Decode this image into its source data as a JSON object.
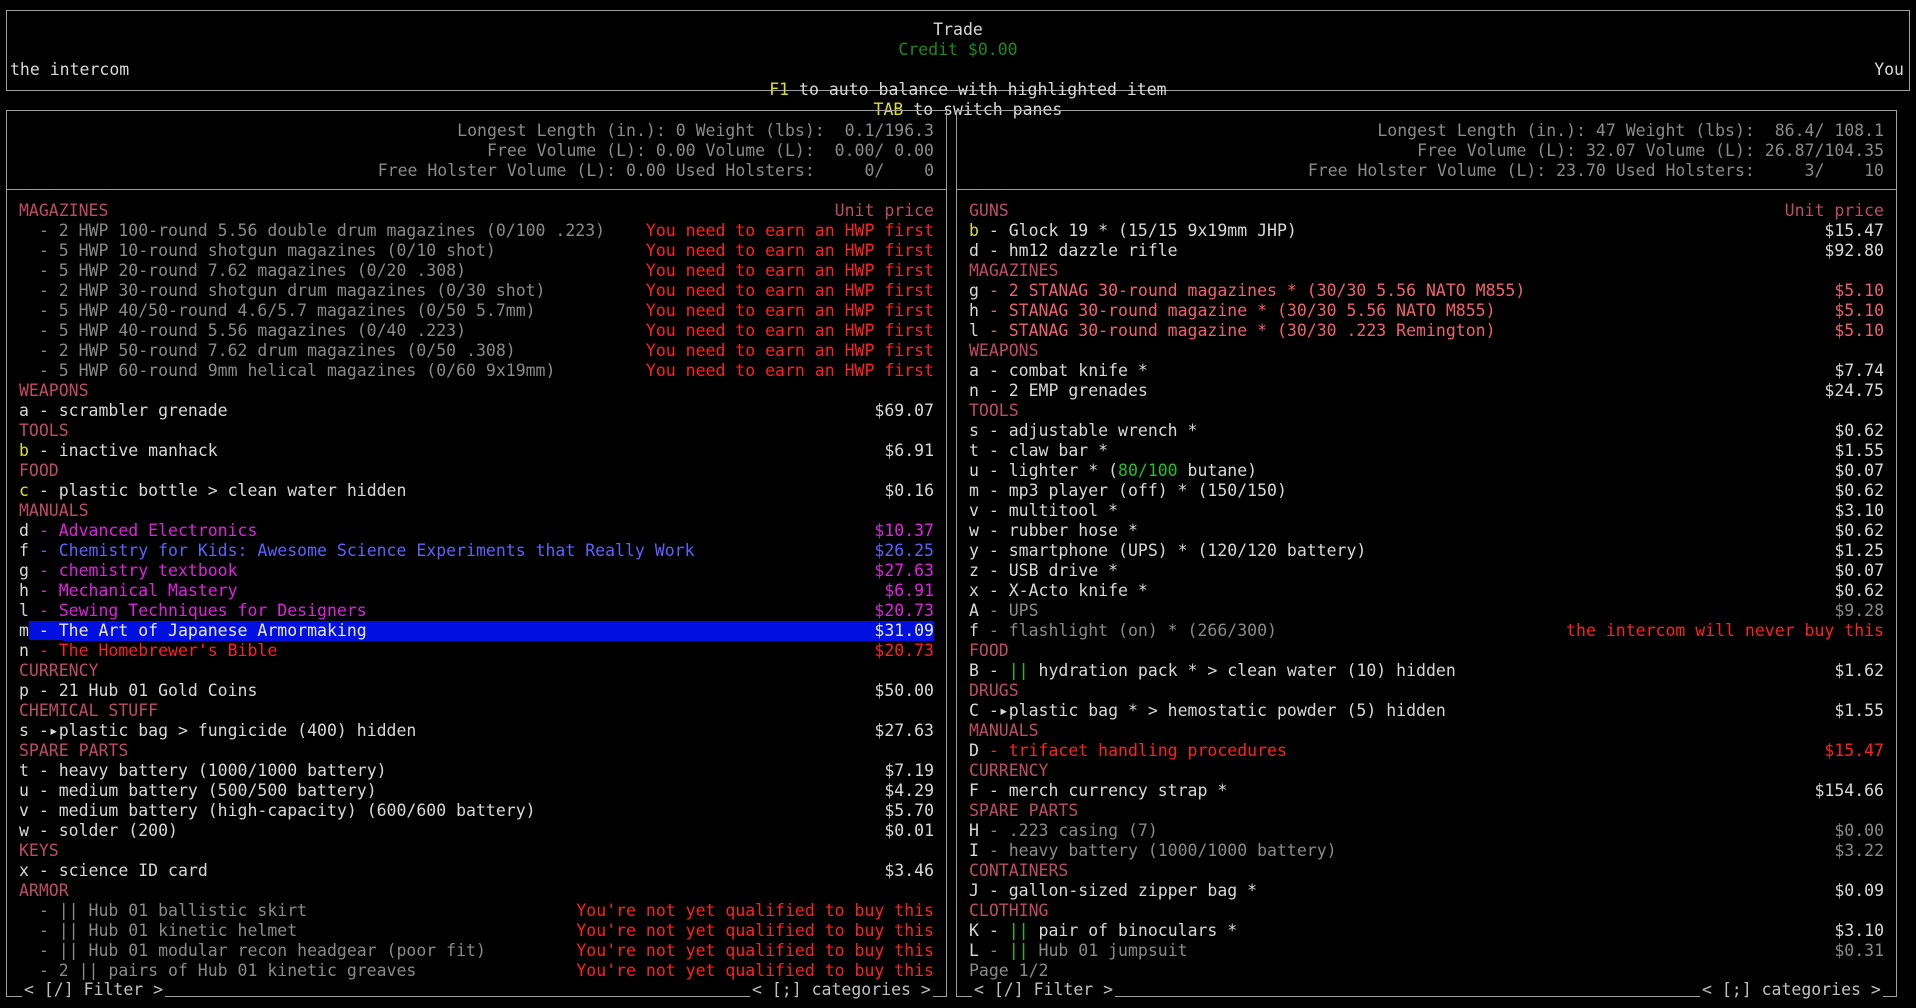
{
  "header": {
    "title": "Trade",
    "credit": "Credit $0.00",
    "npc_name": "the intercom",
    "player_name": "You",
    "f1_key": "F1",
    "f1_text": " to auto balance with highlighted item",
    "tab_key": "TAB",
    "tab_text": " to switch panes"
  },
  "left": {
    "stats": [
      "Longest Length (in.): 0 Weight (lbs):  0.1/196.3",
      "Free Volume (L): 0.00 Volume (L):  0.00/ 0.00",
      "Free Holster Volume (L): 0.00 Used Holsters:     0/    0"
    ],
    "unit_price_label": "Unit price",
    "filter_label": "< [/] Filter >",
    "categories_label": "< [;] categories >",
    "rows": [
      {
        "t": "MAGAZINES",
        "c": "hdr",
        "p": "",
        "pc": ""
      },
      {
        "t": "  - 2 HWP 100-round 5.56 double drum magazines (0/100 .223)",
        "c": "gray",
        "p": "You need to earn an HWP first",
        "pc": "red"
      },
      {
        "t": "  - 5 HWP 10-round shotgun magazines (0/10 shot)",
        "c": "gray",
        "p": "You need to earn an HWP first",
        "pc": "red"
      },
      {
        "t": "  - 5 HWP 20-round 7.62 magazines (0/20 .308)",
        "c": "gray",
        "p": "You need to earn an HWP first",
        "pc": "red"
      },
      {
        "t": "  - 2 HWP 30-round shotgun drum magazines (0/30 shot)",
        "c": "gray",
        "p": "You need to earn an HWP first",
        "pc": "red"
      },
      {
        "t": "  - 5 HWP 40/50-round 4.6/5.7 magazines (0/50 5.7mm)",
        "c": "gray",
        "p": "You need to earn an HWP first",
        "pc": "red"
      },
      {
        "t": "  - 5 HWP 40-round 5.56 magazines (0/40 .223)",
        "c": "gray",
        "p": "You need to earn an HWP first",
        "pc": "red"
      },
      {
        "t": "  - 2 HWP 50-round 7.62 drum magazines (0/50 .308)",
        "c": "gray",
        "p": "You need to earn an HWP first",
        "pc": "red"
      },
      {
        "t": "  - 5 HWP 60-round 9mm helical magazines (0/60 9x19mm)",
        "c": "gray",
        "p": "You need to earn an HWP first",
        "pc": "red"
      },
      {
        "t": "WEAPONS",
        "c": "hdr",
        "p": "",
        "pc": ""
      },
      {
        "k": "a",
        "t": " - scrambler grenade",
        "c": "white",
        "p": "$69.07",
        "pc": "white"
      },
      {
        "t": "TOOLS",
        "c": "hdr",
        "p": "",
        "pc": ""
      },
      {
        "k": "b",
        "kc": "yellow",
        "t": " - inactive manhack",
        "c": "white",
        "p": "$6.91",
        "pc": "white"
      },
      {
        "t": "FOOD",
        "c": "hdr",
        "p": "",
        "pc": ""
      },
      {
        "k": "c",
        "kc": "yellow",
        "t": " - plastic bottle > clean water hidden",
        "c": "white",
        "p": "$0.16",
        "pc": "white"
      },
      {
        "t": "MANUALS",
        "c": "hdr",
        "p": "",
        "pc": ""
      },
      {
        "k": "d",
        "t": " - Advanced Electronics",
        "c": "magenta",
        "p": "$10.37",
        "pc": "magenta"
      },
      {
        "k": "f",
        "t": " - Chemistry for Kids: Awesome Science Experiments that Really Work",
        "c": "blue",
        "p": "$26.25",
        "pc": "blue"
      },
      {
        "k": "g",
        "t": " - chemistry textbook",
        "c": "magenta",
        "p": "$27.63",
        "pc": "magenta"
      },
      {
        "k": "h",
        "t": " - Mechanical Mastery",
        "c": "magenta",
        "p": "$6.91",
        "pc": "magenta"
      },
      {
        "k": "l",
        "t": " - Sewing Techniques for Designers",
        "c": "magenta",
        "p": "$20.73",
        "pc": "magenta"
      },
      {
        "k": "m",
        "t": " - The Art of Japanese Armormaking",
        "c": "sel",
        "p": "$31.09",
        "pc": "sel",
        "selected": true
      },
      {
        "k": "n",
        "t": " - The Homebrewer's Bible",
        "c": "red",
        "p": "$20.73",
        "pc": "red"
      },
      {
        "t": "CURRENCY",
        "c": "hdr",
        "p": "",
        "pc": ""
      },
      {
        "k": "p",
        "t": " - 21 Hub 01 Gold Coins",
        "c": "white",
        "p": "$50.00",
        "pc": "white"
      },
      {
        "t": "CHEMICAL STUFF",
        "c": "hdr",
        "p": "",
        "pc": ""
      },
      {
        "k": "s",
        "t": " -▸plastic bag > fungicide (400) hidden",
        "c": "white",
        "p": "$27.63",
        "pc": "white"
      },
      {
        "t": "SPARE PARTS",
        "c": "hdr",
        "p": "",
        "pc": ""
      },
      {
        "k": "t",
        "t": " - heavy battery (1000/1000 battery)",
        "c": "white",
        "p": "$7.19",
        "pc": "white"
      },
      {
        "k": "u",
        "t": " - medium battery (500/500 battery)",
        "c": "white",
        "p": "$4.29",
        "pc": "white"
      },
      {
        "k": "v",
        "t": " - medium battery (high-capacity) (600/600 battery)",
        "c": "white",
        "p": "$5.70",
        "pc": "white"
      },
      {
        "k": "w",
        "t": " - solder (200)",
        "c": "white",
        "p": "$0.01",
        "pc": "white"
      },
      {
        "t": "KEYS",
        "c": "hdr",
        "p": "",
        "pc": ""
      },
      {
        "k": "x",
        "t": " - science ID card",
        "c": "white",
        "p": "$3.46",
        "pc": "white"
      },
      {
        "t": "ARMOR",
        "c": "hdr",
        "p": "",
        "pc": ""
      },
      {
        "t": "  - || Hub 01 ballistic skirt",
        "c": "gray",
        "p": "You're not yet qualified to buy this",
        "pc": "red"
      },
      {
        "t": "  - || Hub 01 kinetic helmet",
        "c": "gray",
        "p": "You're not yet qualified to buy this",
        "pc": "red"
      },
      {
        "t": "  - || Hub 01 modular recon headgear (poor fit)",
        "c": "gray",
        "p": "You're not yet qualified to buy this",
        "pc": "red"
      },
      {
        "t": "  - 2 || pairs of Hub 01 kinetic greaves",
        "c": "gray",
        "p": "You're not yet qualified to buy this",
        "pc": "red"
      }
    ]
  },
  "right": {
    "stats": [
      "Longest Length (in.): 47 Weight (lbs):  86.4/ 108.1",
      "Free Volume (L): 32.07 Volume (L): 26.87/104.35",
      "Free Holster Volume (L): 23.70 Used Holsters:     3/    10"
    ],
    "unit_price_label": "Unit price",
    "page_label": "Page 1/2",
    "filter_label": "< [/] Filter >",
    "categories_label": "< [;] categories >",
    "rows": [
      {
        "t": "GUNS",
        "c": "hdr",
        "p": "",
        "pc": ""
      },
      {
        "k": "b",
        "kc": "yellow",
        "t": " - Glock 19 * (15/15 9x19mm JHP)",
        "c": "white",
        "p": "$15.47",
        "pc": "white"
      },
      {
        "k": "d",
        "t": " - hm12 dazzle rifle",
        "c": "white",
        "p": "$92.80",
        "pc": "white"
      },
      {
        "t": "MAGAZINES",
        "c": "hdr",
        "p": "",
        "pc": ""
      },
      {
        "k": "g",
        "t": " - 2 STANAG 30-round magazines * (30/30 5.56 NATO M855)",
        "c": "salmon",
        "p": "$5.10",
        "pc": "salmon"
      },
      {
        "k": "h",
        "t": " - STANAG 30-round magazine * (30/30 5.56 NATO M855)",
        "c": "salmon",
        "p": "$5.10",
        "pc": "salmon"
      },
      {
        "k": "l",
        "t": " - STANAG 30-round magazine * (30/30 .223 Remington)",
        "c": "salmon",
        "p": "$5.10",
        "pc": "salmon"
      },
      {
        "t": "WEAPONS",
        "c": "hdr",
        "p": "",
        "pc": ""
      },
      {
        "k": "a",
        "t": " - combat knife *",
        "c": "white",
        "p": "$7.74",
        "pc": "white"
      },
      {
        "k": "n",
        "t": " - 2 EMP grenades",
        "c": "white",
        "p": "$24.75",
        "pc": "white"
      },
      {
        "t": "TOOLS",
        "c": "hdr",
        "p": "",
        "pc": ""
      },
      {
        "k": "s",
        "t": " - adjustable wrench *",
        "c": "white",
        "p": "$0.62",
        "pc": "white"
      },
      {
        "k": "t",
        "t": " - claw bar *",
        "c": "white",
        "p": "$1.55",
        "pc": "white"
      },
      {
        "k": "u",
        "t": " - lighter * (",
        "g": "80/100",
        "t2": " butane)",
        "c": "white",
        "p": "$0.07",
        "pc": "white"
      },
      {
        "k": "m",
        "t": " - mp3 player (off) * (150/150)",
        "c": "white",
        "p": "$0.62",
        "pc": "white"
      },
      {
        "k": "v",
        "t": " - multitool *",
        "c": "white",
        "p": "$3.10",
        "pc": "white"
      },
      {
        "k": "w",
        "t": " - rubber hose *",
        "c": "white",
        "p": "$0.62",
        "pc": "white"
      },
      {
        "k": "y",
        "t": " - smartphone (UPS) * (120/120 battery)",
        "c": "white",
        "p": "$1.25",
        "pc": "white"
      },
      {
        "k": "z",
        "t": " - USB drive *",
        "c": "white",
        "p": "$0.07",
        "pc": "white"
      },
      {
        "k": "x",
        "t": " - X-Acto knife *",
        "c": "white",
        "p": "$0.62",
        "pc": "white"
      },
      {
        "k": "A",
        "t": " - UPS",
        "c": "gray",
        "p": "$9.28",
        "pc": "gray"
      },
      {
        "k": "f",
        "t": " - flashlight (on) * (266/300)",
        "c": "gray",
        "p": "the intercom will never buy this",
        "pc": "red"
      },
      {
        "t": "FOOD",
        "c": "hdr",
        "p": "",
        "pc": ""
      },
      {
        "k": "B",
        "t": " - ",
        "g": "||",
        "t2": " hydration pack * > clean water (10) hidden",
        "c": "white",
        "p": "$1.62",
        "pc": "white"
      },
      {
        "t": "DRUGS",
        "c": "hdr",
        "p": "",
        "pc": ""
      },
      {
        "k": "C",
        "t": " -▸plastic bag * > hemostatic powder (5) hidden",
        "c": "white",
        "p": "$1.55",
        "pc": "white"
      },
      {
        "t": "MANUALS",
        "c": "hdr",
        "p": "",
        "pc": ""
      },
      {
        "k": "D",
        "t": " - trifacet handling procedures",
        "c": "red",
        "p": "$15.47",
        "pc": "red"
      },
      {
        "t": "CURRENCY",
        "c": "hdr",
        "p": "",
        "pc": ""
      },
      {
        "k": "F",
        "t": " - merch currency strap *",
        "c": "white",
        "p": "$154.66",
        "pc": "white"
      },
      {
        "t": "SPARE PARTS",
        "c": "hdr",
        "p": "",
        "pc": ""
      },
      {
        "k": "H",
        "t": " - .223 casing (7)",
        "c": "gray",
        "p": "$0.00",
        "pc": "gray"
      },
      {
        "k": "I",
        "t": " - heavy battery (1000/1000 battery)",
        "c": "gray",
        "p": "$3.22",
        "pc": "gray"
      },
      {
        "t": "CONTAINERS",
        "c": "hdr",
        "p": "",
        "pc": ""
      },
      {
        "k": "J",
        "t": " - gallon-sized zipper bag *",
        "c": "white",
        "p": "$0.09",
        "pc": "white"
      },
      {
        "t": "CLOTHING",
        "c": "hdr",
        "p": "",
        "pc": ""
      },
      {
        "k": "K",
        "t": " - ",
        "g": "||",
        "t2": " pair of binoculars *",
        "c": "white",
        "p": "$3.10",
        "pc": "white"
      },
      {
        "k": "L",
        "t": " - ",
        "g": "||",
        "t2": " Hub 01 jumpsuit",
        "c": "gray",
        "p": "$0.31",
        "pc": "gray"
      }
    ]
  }
}
